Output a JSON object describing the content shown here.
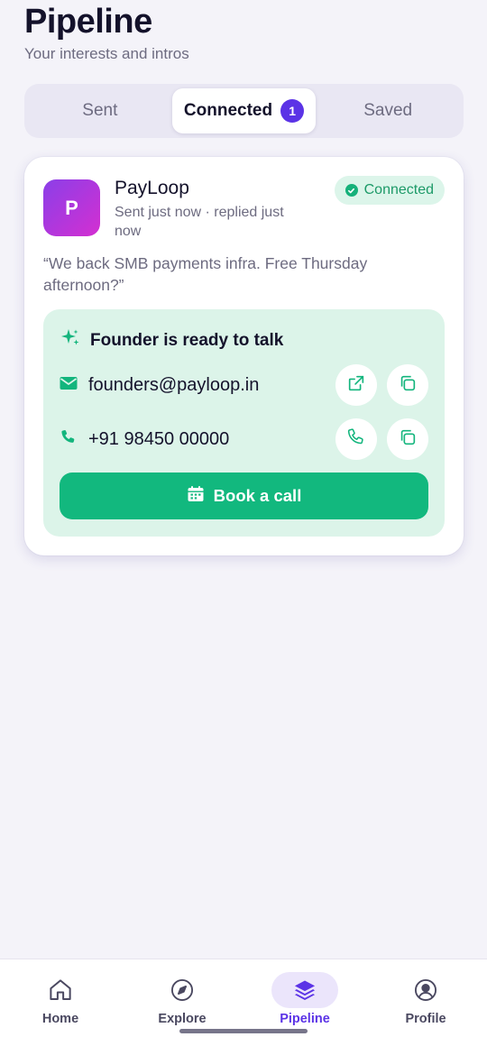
{
  "header": {
    "title": "Pipeline",
    "subtitle": "Your interests and intros"
  },
  "tabs": [
    {
      "label": "Sent"
    },
    {
      "label": "Connected",
      "badge": "1"
    },
    {
      "label": "Saved"
    }
  ],
  "active_tab": "Connected",
  "card": {
    "avatar_letter": "P",
    "company": "PayLoop",
    "meta": "Sent just now · replied just now",
    "status": "Connected",
    "quote": "“We back SMB payments infra. Free Thursday afternoon?”",
    "contact": {
      "heading": "Founder is ready to talk",
      "email": "founders@payloop.in",
      "phone": "+91 98450 00000",
      "book_label": "Book a call"
    }
  },
  "bottom_nav": [
    {
      "label": "Home",
      "icon": "home-icon"
    },
    {
      "label": "Explore",
      "icon": "compass-icon"
    },
    {
      "label": "Pipeline",
      "icon": "layers-icon"
    },
    {
      "label": "Profile",
      "icon": "user-circle-icon"
    }
  ],
  "active_nav": "Pipeline",
  "colors": {
    "accent": "#5b33e6",
    "success": "#12b87e",
    "success_bg": "#dcf4e9",
    "avatar_gradient_start": "#8b3fe8",
    "avatar_gradient_end": "#d42fd1"
  }
}
